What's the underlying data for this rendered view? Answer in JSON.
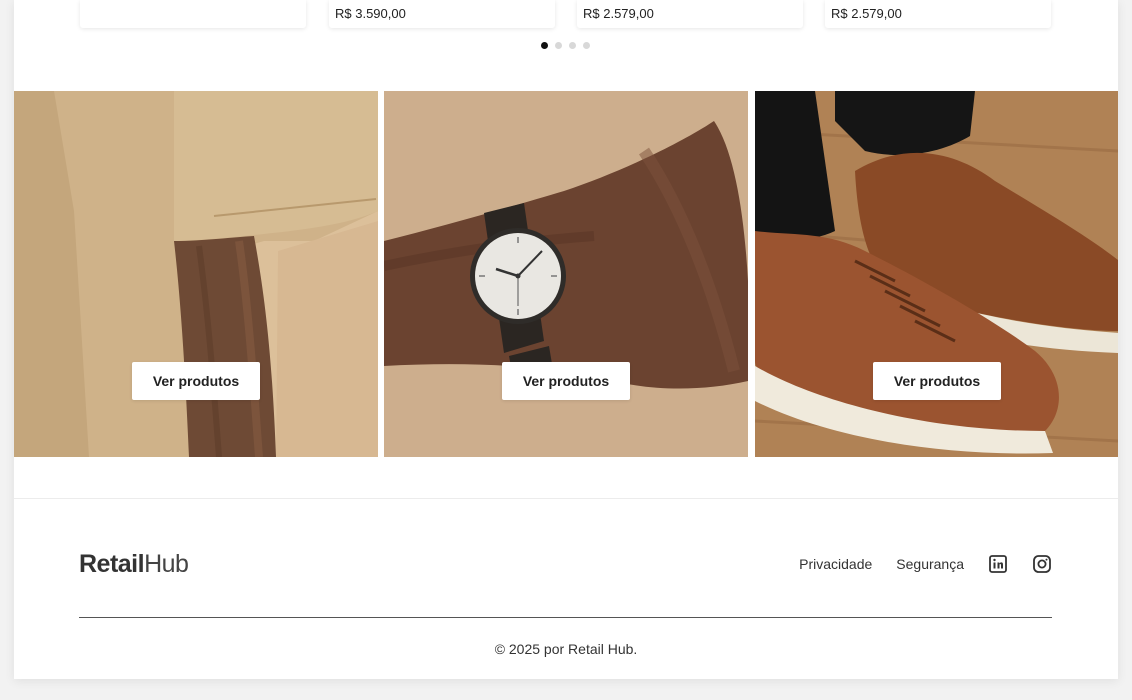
{
  "products": [
    {
      "price": ""
    },
    {
      "price": "R$ 3.590,00"
    },
    {
      "price": "R$ 2.579,00"
    },
    {
      "price": "R$ 2.579,00"
    }
  ],
  "carousel": {
    "pages": 4,
    "active": 0
  },
  "categories": [
    {
      "button": "Ver produtos",
      "image": "arm-in-beige-tshirt"
    },
    {
      "button": "Ver produtos",
      "image": "wrist-with-watch"
    },
    {
      "button": "Ver produtos",
      "image": "brown-leather-sneakers"
    }
  ],
  "footer": {
    "logo_bold": "Retail",
    "logo_light": "Hub",
    "links": [
      "Privacidade",
      "Segurança"
    ],
    "social": [
      "linkedin-icon",
      "instagram-icon"
    ],
    "copyright": "© 2025 por Retail Hub."
  },
  "colors": {
    "accent": "#111111",
    "background": "#ffffff"
  }
}
